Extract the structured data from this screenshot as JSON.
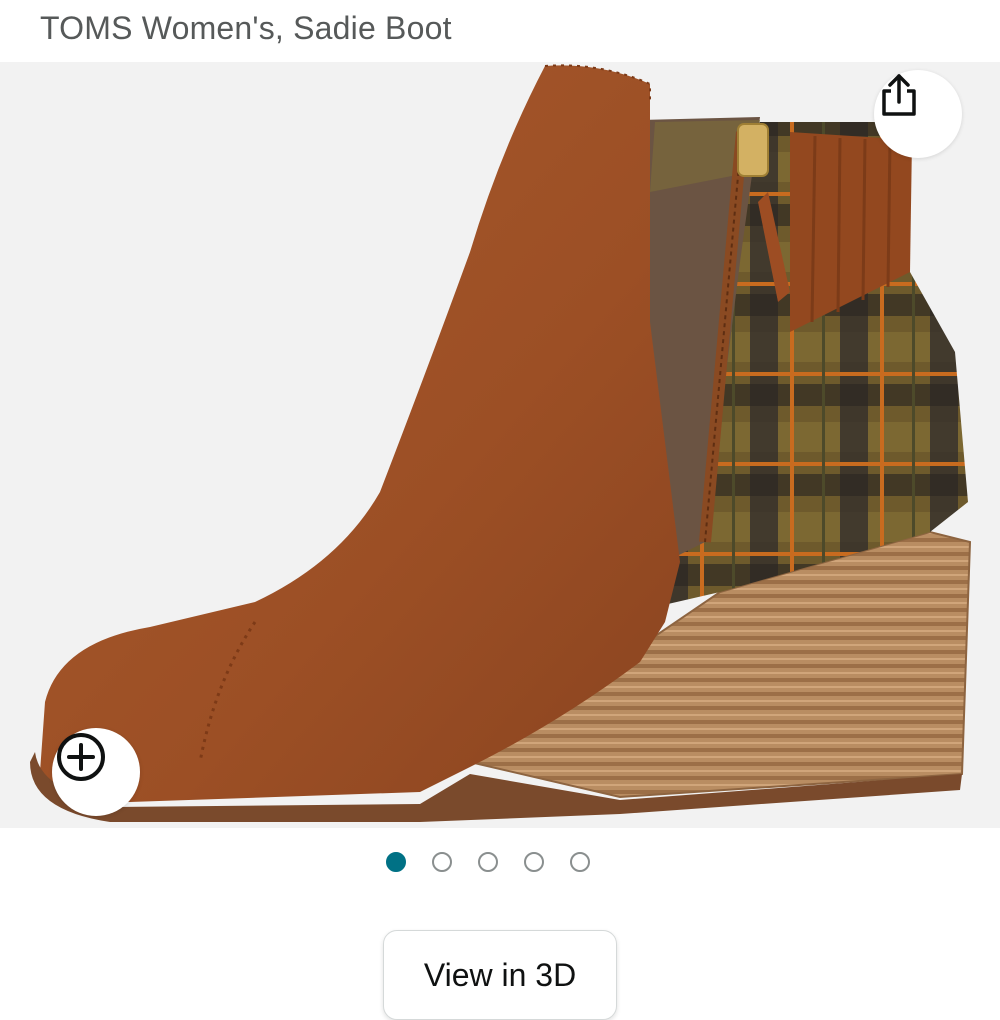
{
  "product": {
    "title": "TOMS Women's, Sadie Boot"
  },
  "gallery": {
    "image_count": 5,
    "active_index": 0,
    "share_icon": "share-icon",
    "zoom_icon": "zoom-plus-icon"
  },
  "actions": {
    "view_3d_label": "View in 3D"
  },
  "colors": {
    "title_text": "#565959",
    "active_dot": "#007185",
    "image_background": "#f2f2f2",
    "suede": "#a4552a",
    "wood_wedge": "#b98d62"
  }
}
